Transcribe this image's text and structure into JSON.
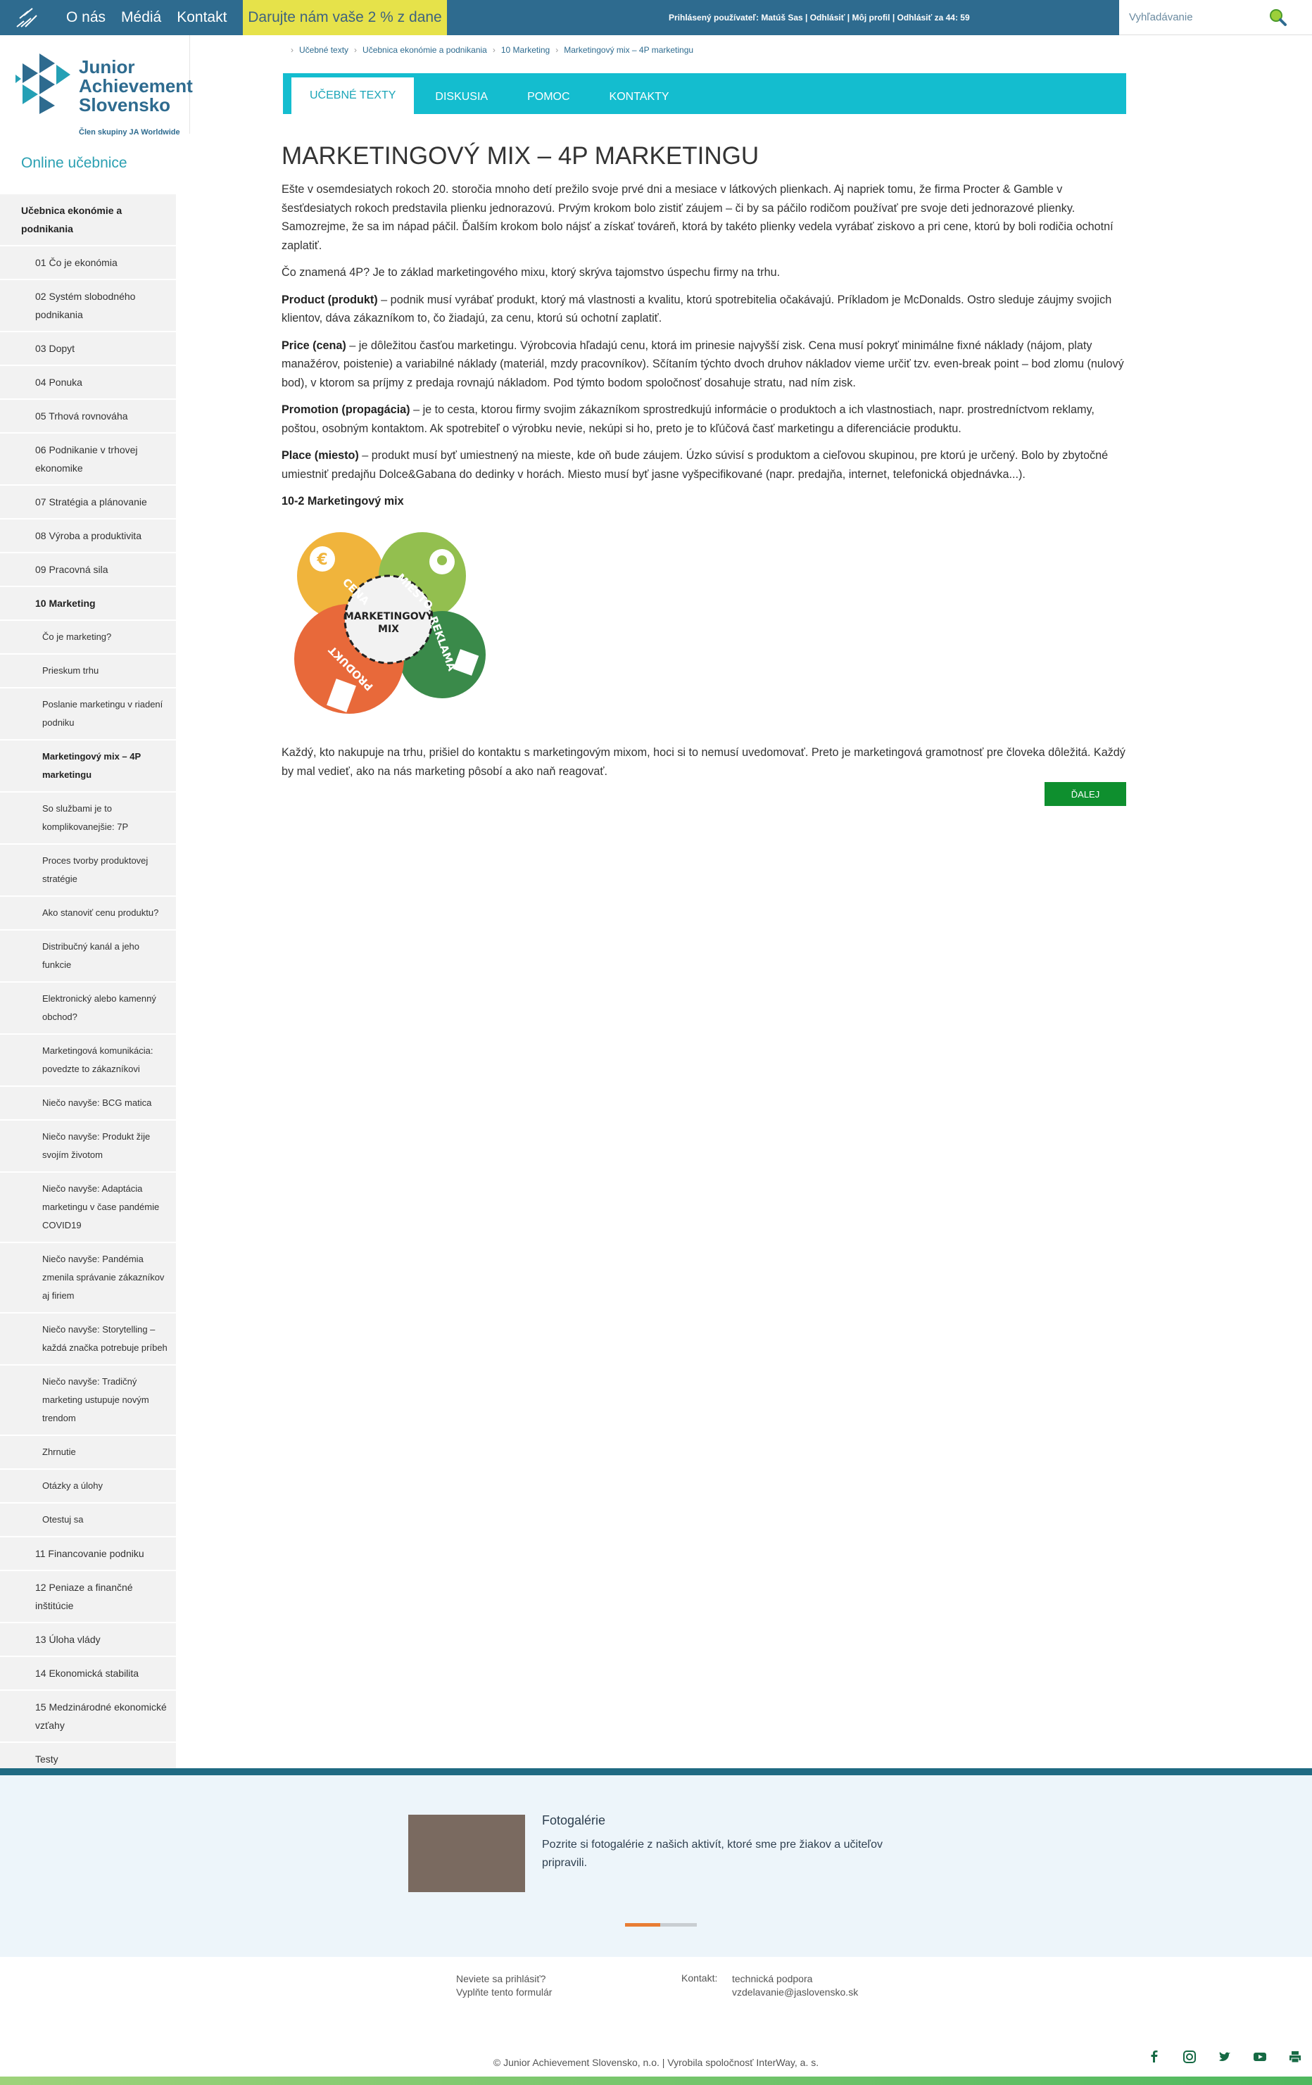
{
  "topbar": {
    "nav": [
      "O nás",
      "Médiá",
      "Kontakt"
    ],
    "promo": "Darujte nám vaše 2 % z dane",
    "login": "Prihlásený používateľ: Matúš Sas | Odhlásiť | Môj profil | Odhlásiť za 44: 59",
    "search_placeholder": "Vyhľadávanie"
  },
  "brand": {
    "name_line1": "Junior",
    "name_line2": "Achievement",
    "name_line3": "Slovensko",
    "tagline": "Člen skupiny JA Worldwide"
  },
  "sidebar": {
    "heading": "Online učebnice",
    "items": [
      {
        "label": "Učebnica ekonómie a podnikania",
        "level": "top"
      },
      {
        "label": "01 Čo je ekonómia",
        "level": "ch"
      },
      {
        "label": "02 Systém slobodného podnikania",
        "level": "ch"
      },
      {
        "label": "03 Dopyt",
        "level": "ch"
      },
      {
        "label": "04 Ponuka",
        "level": "ch"
      },
      {
        "label": "05 Trhová rovnováha",
        "level": "ch"
      },
      {
        "label": "06 Podnikanie v trhovej ekonomike",
        "level": "ch"
      },
      {
        "label": "07 Stratégia a plánovanie",
        "level": "ch"
      },
      {
        "label": "08 Výroba a produktivita",
        "level": "ch"
      },
      {
        "label": "09 Pracovná sila",
        "level": "ch"
      },
      {
        "label": "10 Marketing",
        "level": "chbold"
      },
      {
        "label": "Čo je marketing?",
        "level": "sub"
      },
      {
        "label": "Prieskum trhu",
        "level": "sub"
      },
      {
        "label": "Poslanie marketingu v riadení podniku",
        "level": "sub"
      },
      {
        "label": "Marketingový mix – 4P marketingu",
        "level": "subbold"
      },
      {
        "label": "So službami je to komplikovanejšie: 7P",
        "level": "sub"
      },
      {
        "label": "Proces tvorby produktovej stratégie",
        "level": "sub"
      },
      {
        "label": "Ako stanoviť cenu produktu?",
        "level": "sub"
      },
      {
        "label": "Distribučný kanál a jeho funkcie",
        "level": "sub"
      },
      {
        "label": "Elektronický alebo kamenný obchod?",
        "level": "sub"
      },
      {
        "label": "Marketingová komunikácia: povedzte to zákazníkovi",
        "level": "sub"
      },
      {
        "label": "Niečo navyše: BCG matica",
        "level": "sub"
      },
      {
        "label": "Niečo navyše: Produkt žije svojím životom",
        "level": "sub"
      },
      {
        "label": "Niečo navyše: Adaptácia marketingu v čase pandémie COVID19",
        "level": "sub"
      },
      {
        "label": "Niečo navyše: Pandémia zmenila správanie zákazníkov aj firiem",
        "level": "sub"
      },
      {
        "label": "Niečo navyše: Storytelling – každá značka potrebuje príbeh",
        "level": "sub"
      },
      {
        "label": "Niečo navyše: Tradičný marketing ustupuje novým trendom",
        "level": "sub"
      },
      {
        "label": "Zhrnutie",
        "level": "sub"
      },
      {
        "label": "Otázky a úlohy",
        "level": "sub"
      },
      {
        "label": "Otestuj sa",
        "level": "sub"
      },
      {
        "label": "11 Financovanie podniku",
        "level": "ch"
      },
      {
        "label": "12 Peniaze a finančné inštitúcie",
        "level": "ch"
      },
      {
        "label": "13 Úloha vlády",
        "level": "ch"
      },
      {
        "label": "14 Ekonomická stabilita",
        "level": "ch"
      },
      {
        "label": "15 Medzinárodné ekonomické vzťahy",
        "level": "ch"
      },
      {
        "label": "Testy",
        "level": "ch"
      }
    ]
  },
  "breadcrumb": [
    "Učebné texty",
    "Učebnica ekonómie a podnikania",
    "10 Marketing",
    "Marketingový mix – 4P marketingu"
  ],
  "tabs": [
    "UČEBNÉ TEXTY",
    "DISKUSIA",
    "POMOC",
    "KONTAKTY"
  ],
  "article": {
    "title": "MARKETINGOVÝ MIX – 4P MARKETINGU",
    "p1": "Ešte v osemdesiatych rokoch 20. storočia mnoho detí prežilo svoje prvé dni a mesiace v látkových plienkach. Aj napriek tomu, že firma Procter & Gamble v šesťdesiatych rokoch predstavila plienku jednorazovú. Prvým krokom bolo zistiť záujem – či by sa páčilo rodičom používať pre svoje deti jednorazové plienky. Samozrejme, že sa im nápad páčil. Ďalším krokom bolo nájsť a získať továreň, ktorá by takéto plienky vedela vyrábať ziskovo a pri cene, ktorú by boli rodičia ochotní zaplatiť.",
    "p2": "Čo znamená 4P? Je to základ marketingového mixu, ktorý skrýva tajomstvo úspechu firmy na trhu.",
    "product_term": "Product (produkt)",
    "product_text": " – podnik musí vyrábať produkt, ktorý má vlastnosti a kvalitu, ktorú spotrebitelia očakávajú. Príkladom je McDonalds. Ostro sleduje záujmy svojich klientov, dáva zákazníkom to, čo žiadajú, za cenu, ktorú sú ochotní zaplatiť.",
    "price_term": "Price (cena)",
    "price_text": " – je dôležitou časťou marketingu. Výrobcovia hľadajú cenu, ktorá im prinesie najvyšší zisk. Cena musí pokryť minimálne fixné náklady (nájom, platy manažérov, poistenie) a variabilné náklady (materiál, mzdy pracovníkov). Sčítaním týchto dvoch druhov nákladov vieme určiť tzv. even-break point – bod zlomu (nulový bod), v ktorom sa príjmy z predaja rovnajú nákladom. Pod týmto bodom spoločnosť dosahuje stratu, nad ním zisk.",
    "promotion_term": "Promotion (propagácia)",
    "promotion_text": " – je to cesta, ktorou firmy svojim zákazníkom sprostredkujú informácie o produktoch a ich vlastnostiach, napr. prostredníctvom reklamy, poštou, osobným kontaktom. Ak spotrebiteľ o výrobku nevie, nekúpi si ho, preto je to kľúčová časť marketingu a diferenciácie produktu.",
    "place_term": "Place (miesto)",
    "place_text": " – produkt musí byť umiestnený na mieste, kde oň bude záujem. Úzko súvisí s produktom a cieľovou skupinou, pre ktorú je určený. Bolo by zbytočné umiestniť predajňu Dolce&Gabana do dedinky v horách. Miesto musí byť jasne vyšpecifikované (napr. predajňa, internet, telefonická objednávka...).",
    "figure_title": "10-2 Marketingový mix",
    "p_end": "Každý, kto nakupuje na trhu, prišiel do kontaktu s marketingovým mixom, hoci si to nemusí uvedomovať. Preto je marketingová gramotnosť pre človeka dôležitá. Každý by mal vedieť, ako na nás marketing pôsobí a ako naň reagovať.",
    "next_label": "ĎALEJ"
  },
  "diagram": {
    "center_line1": "MARKETINGOVÝ",
    "center_line2": "MIX",
    "cena": "CENA",
    "miesto": "MIESTO",
    "reklama": "REKLAMA",
    "produkt": "PRODUKT",
    "colors": {
      "cena": "#f0b43c",
      "miesto": "#93bf4f",
      "reklama": "#3a8a4a",
      "produkt": "#e8693a"
    }
  },
  "gallery": {
    "title": "Fotogalérie",
    "text": "Pozrite si fotogalérie z našich aktivít, ktoré sme pre žiakov a učiteľov pripravili."
  },
  "footer": {
    "login_q": "Neviete sa prihlásiť?",
    "login_link": "Vyplňte tento formulár",
    "contact_label": "Kontakt:",
    "support": "technická podpora",
    "email": "vzdelavanie@jaslovensko.sk",
    "copyright": "© Junior Achievement Slovensko, n.o. | Vyrobila spoločnosť InterWay, a. s."
  }
}
